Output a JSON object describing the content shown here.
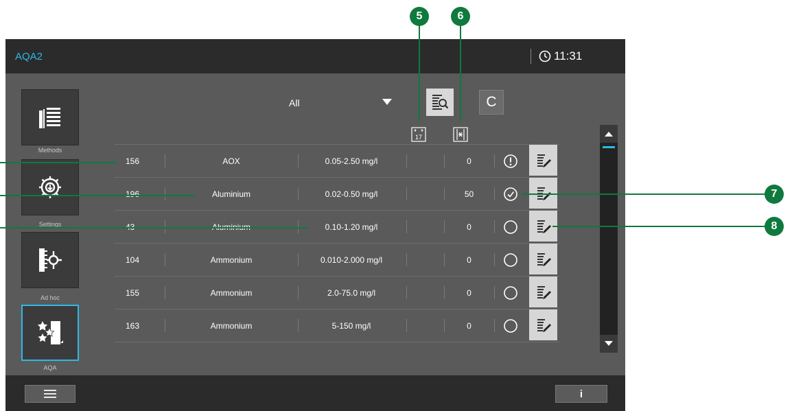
{
  "app": {
    "title": "AQA2",
    "time": "11:31"
  },
  "sidebar": {
    "items": [
      {
        "label": "Methods"
      },
      {
        "label": "Settings"
      },
      {
        "label": "Ad hoc"
      },
      {
        "label": "AQA"
      }
    ]
  },
  "filter": {
    "selected": "All"
  },
  "toolbar": {
    "c_label": "C"
  },
  "header_icons": {
    "sort_label": "17"
  },
  "table": {
    "rows": [
      {
        "id": "156",
        "name": "AOX",
        "range": "0.05-2.50 mg/l",
        "count": "0",
        "status": "warning"
      },
      {
        "id": "196",
        "name": "Aluminium",
        "range": "0.02-0.50 mg/l",
        "count": "50",
        "status": "ok"
      },
      {
        "id": "43",
        "name": "Aluminium",
        "range": "0.10-1.20 mg/l",
        "count": "0",
        "status": "empty"
      },
      {
        "id": "104",
        "name": "Ammonium",
        "range": "0.010-2.000 mg/l",
        "count": "0",
        "status": "empty"
      },
      {
        "id": "155",
        "name": "Ammonium",
        "range": "2.0-75.0 mg/l",
        "count": "0",
        "status": "empty"
      },
      {
        "id": "163",
        "name": "Ammonium",
        "range": "5-150 mg/l",
        "count": "0",
        "status": "empty"
      }
    ]
  },
  "bottom": {
    "info_label": "i"
  },
  "callouts": [
    "5",
    "6",
    "7",
    "8"
  ],
  "colors": {
    "accent": "#2fb8e8",
    "callout": "#0f7a3d"
  }
}
